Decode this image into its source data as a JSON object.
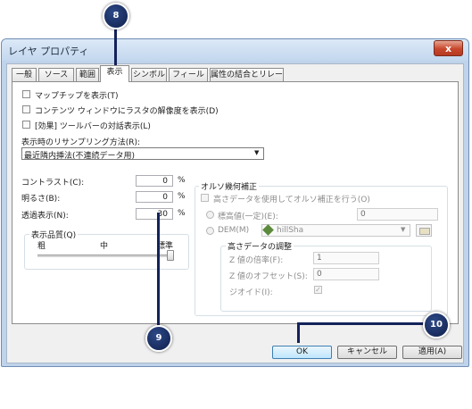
{
  "window": {
    "title": "レイヤ プロパティ",
    "close_glyph": "x"
  },
  "tabs": [
    {
      "label": "一般",
      "active": false
    },
    {
      "label": "ソース",
      "active": false
    },
    {
      "label": "範囲",
      "active": false
    },
    {
      "label": "表示",
      "active": true
    },
    {
      "label": "シンボル",
      "active": false
    },
    {
      "label": "フィールド",
      "active": false
    },
    {
      "label": "属性の結合とリレート",
      "active": false
    }
  ],
  "checkboxes": {
    "map_tips": "マップチップを表示(T)",
    "toc_resolution": "コンテンツ ウィンドウにラスタの解像度を表示(D)",
    "effects_toolbar": "[効果] ツールバーの対話表示(L)"
  },
  "resampling": {
    "label": "表示時のリサンプリング方法(R):",
    "value": "最近隣内挿法(不連続データ用)"
  },
  "contrast": {
    "label": "コントラスト(C):",
    "value": "0",
    "unit": "%"
  },
  "brightness": {
    "label": "明るさ(B):",
    "value": "0",
    "unit": "%"
  },
  "transparency": {
    "label": "透過表示(N):",
    "value": "30",
    "unit": "%"
  },
  "quality": {
    "title": "表示品質(Q)",
    "ticks": [
      "粗",
      "中",
      "標準"
    ],
    "level": "標準"
  },
  "ortho": {
    "title": "オルソ幾何補正",
    "use_ortho": "高さデータを使用してオルソ補正を行う(O)",
    "constant_label": "標高値(一定)(E):",
    "constant_value": "0",
    "dem_label": "DEM(M)",
    "dem_value": "hillSha",
    "adjust": {
      "title": "高さデータの調整",
      "z_factor_label": "Z 値の倍率(F):",
      "z_factor_value": "1",
      "z_offset_label": "Z 値のオフセット(S):",
      "z_offset_value": "0",
      "geoid_label": "ジオイド(I):",
      "geoid_mark": "✓"
    }
  },
  "buttons": {
    "ok": "OK",
    "cancel": "キャンセル",
    "apply": "適用(A)"
  },
  "callouts": {
    "c8": "8",
    "c9": "9",
    "c10": "10"
  },
  "colors": {
    "callout": "#13225a",
    "accent": "#3c7fb1"
  }
}
